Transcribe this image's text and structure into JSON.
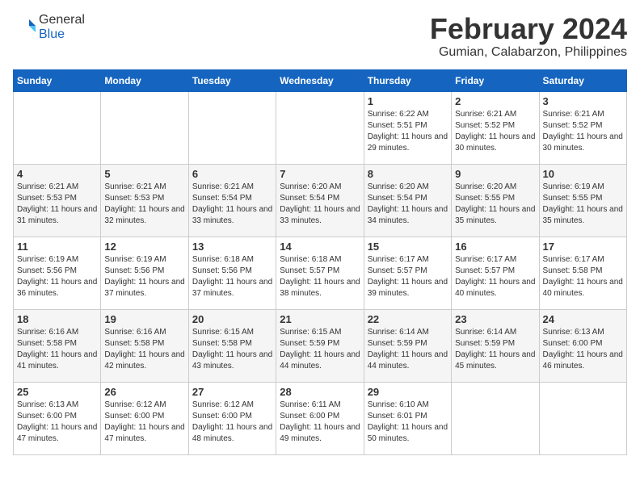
{
  "header": {
    "logo_line1": "General",
    "logo_line2": "Blue",
    "title": "February 2024",
    "subtitle": "Gumian, Calabarzon, Philippines"
  },
  "columns": [
    "Sunday",
    "Monday",
    "Tuesday",
    "Wednesday",
    "Thursday",
    "Friday",
    "Saturday"
  ],
  "weeks": [
    [
      {
        "day": "",
        "sunrise": "",
        "sunset": "",
        "daylight": ""
      },
      {
        "day": "",
        "sunrise": "",
        "sunset": "",
        "daylight": ""
      },
      {
        "day": "",
        "sunrise": "",
        "sunset": "",
        "daylight": ""
      },
      {
        "day": "",
        "sunrise": "",
        "sunset": "",
        "daylight": ""
      },
      {
        "day": "1",
        "sunrise": "Sunrise: 6:22 AM",
        "sunset": "Sunset: 5:51 PM",
        "daylight": "Daylight: 11 hours and 29 minutes."
      },
      {
        "day": "2",
        "sunrise": "Sunrise: 6:21 AM",
        "sunset": "Sunset: 5:52 PM",
        "daylight": "Daylight: 11 hours and 30 minutes."
      },
      {
        "day": "3",
        "sunrise": "Sunrise: 6:21 AM",
        "sunset": "Sunset: 5:52 PM",
        "daylight": "Daylight: 11 hours and 30 minutes."
      }
    ],
    [
      {
        "day": "4",
        "sunrise": "Sunrise: 6:21 AM",
        "sunset": "Sunset: 5:53 PM",
        "daylight": "Daylight: 11 hours and 31 minutes."
      },
      {
        "day": "5",
        "sunrise": "Sunrise: 6:21 AM",
        "sunset": "Sunset: 5:53 PM",
        "daylight": "Daylight: 11 hours and 32 minutes."
      },
      {
        "day": "6",
        "sunrise": "Sunrise: 6:21 AM",
        "sunset": "Sunset: 5:54 PM",
        "daylight": "Daylight: 11 hours and 33 minutes."
      },
      {
        "day": "7",
        "sunrise": "Sunrise: 6:20 AM",
        "sunset": "Sunset: 5:54 PM",
        "daylight": "Daylight: 11 hours and 33 minutes."
      },
      {
        "day": "8",
        "sunrise": "Sunrise: 6:20 AM",
        "sunset": "Sunset: 5:54 PM",
        "daylight": "Daylight: 11 hours and 34 minutes."
      },
      {
        "day": "9",
        "sunrise": "Sunrise: 6:20 AM",
        "sunset": "Sunset: 5:55 PM",
        "daylight": "Daylight: 11 hours and 35 minutes."
      },
      {
        "day": "10",
        "sunrise": "Sunrise: 6:19 AM",
        "sunset": "Sunset: 5:55 PM",
        "daylight": "Daylight: 11 hours and 35 minutes."
      }
    ],
    [
      {
        "day": "11",
        "sunrise": "Sunrise: 6:19 AM",
        "sunset": "Sunset: 5:56 PM",
        "daylight": "Daylight: 11 hours and 36 minutes."
      },
      {
        "day": "12",
        "sunrise": "Sunrise: 6:19 AM",
        "sunset": "Sunset: 5:56 PM",
        "daylight": "Daylight: 11 hours and 37 minutes."
      },
      {
        "day": "13",
        "sunrise": "Sunrise: 6:18 AM",
        "sunset": "Sunset: 5:56 PM",
        "daylight": "Daylight: 11 hours and 37 minutes."
      },
      {
        "day": "14",
        "sunrise": "Sunrise: 6:18 AM",
        "sunset": "Sunset: 5:57 PM",
        "daylight": "Daylight: 11 hours and 38 minutes."
      },
      {
        "day": "15",
        "sunrise": "Sunrise: 6:17 AM",
        "sunset": "Sunset: 5:57 PM",
        "daylight": "Daylight: 11 hours and 39 minutes."
      },
      {
        "day": "16",
        "sunrise": "Sunrise: 6:17 AM",
        "sunset": "Sunset: 5:57 PM",
        "daylight": "Daylight: 11 hours and 40 minutes."
      },
      {
        "day": "17",
        "sunrise": "Sunrise: 6:17 AM",
        "sunset": "Sunset: 5:58 PM",
        "daylight": "Daylight: 11 hours and 40 minutes."
      }
    ],
    [
      {
        "day": "18",
        "sunrise": "Sunrise: 6:16 AM",
        "sunset": "Sunset: 5:58 PM",
        "daylight": "Daylight: 11 hours and 41 minutes."
      },
      {
        "day": "19",
        "sunrise": "Sunrise: 6:16 AM",
        "sunset": "Sunset: 5:58 PM",
        "daylight": "Daylight: 11 hours and 42 minutes."
      },
      {
        "day": "20",
        "sunrise": "Sunrise: 6:15 AM",
        "sunset": "Sunset: 5:58 PM",
        "daylight": "Daylight: 11 hours and 43 minutes."
      },
      {
        "day": "21",
        "sunrise": "Sunrise: 6:15 AM",
        "sunset": "Sunset: 5:59 PM",
        "daylight": "Daylight: 11 hours and 44 minutes."
      },
      {
        "day": "22",
        "sunrise": "Sunrise: 6:14 AM",
        "sunset": "Sunset: 5:59 PM",
        "daylight": "Daylight: 11 hours and 44 minutes."
      },
      {
        "day": "23",
        "sunrise": "Sunrise: 6:14 AM",
        "sunset": "Sunset: 5:59 PM",
        "daylight": "Daylight: 11 hours and 45 minutes."
      },
      {
        "day": "24",
        "sunrise": "Sunrise: 6:13 AM",
        "sunset": "Sunset: 6:00 PM",
        "daylight": "Daylight: 11 hours and 46 minutes."
      }
    ],
    [
      {
        "day": "25",
        "sunrise": "Sunrise: 6:13 AM",
        "sunset": "Sunset: 6:00 PM",
        "daylight": "Daylight: 11 hours and 47 minutes."
      },
      {
        "day": "26",
        "sunrise": "Sunrise: 6:12 AM",
        "sunset": "Sunset: 6:00 PM",
        "daylight": "Daylight: 11 hours and 47 minutes."
      },
      {
        "day": "27",
        "sunrise": "Sunrise: 6:12 AM",
        "sunset": "Sunset: 6:00 PM",
        "daylight": "Daylight: 11 hours and 48 minutes."
      },
      {
        "day": "28",
        "sunrise": "Sunrise: 6:11 AM",
        "sunset": "Sunset: 6:00 PM",
        "daylight": "Daylight: 11 hours and 49 minutes."
      },
      {
        "day": "29",
        "sunrise": "Sunrise: 6:10 AM",
        "sunset": "Sunset: 6:01 PM",
        "daylight": "Daylight: 11 hours and 50 minutes."
      },
      {
        "day": "",
        "sunrise": "",
        "sunset": "",
        "daylight": ""
      },
      {
        "day": "",
        "sunrise": "",
        "sunset": "",
        "daylight": ""
      }
    ]
  ]
}
